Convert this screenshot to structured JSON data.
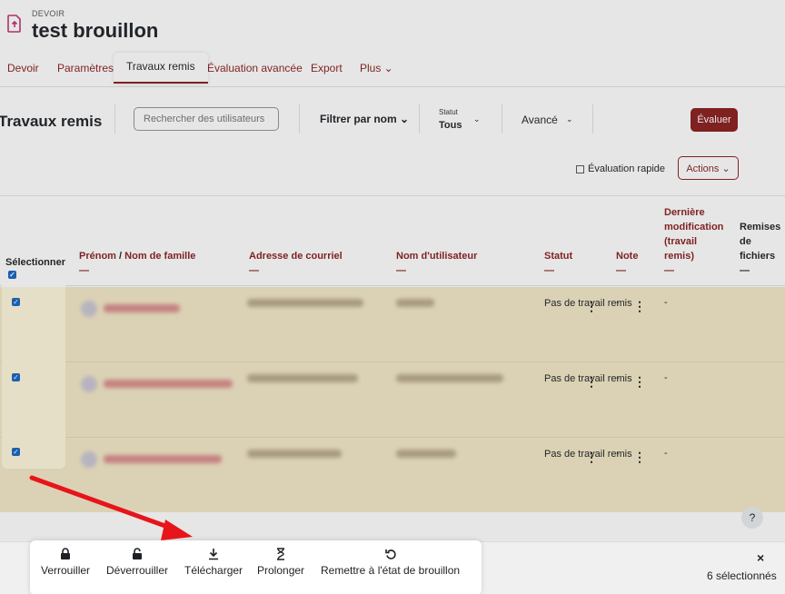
{
  "header": {
    "kicker": "DEVOIR",
    "title": "test brouillon"
  },
  "tabs": [
    {
      "label": "Devoir"
    },
    {
      "label": "Paramètres"
    },
    {
      "label": "Travaux remis"
    },
    {
      "label": "Évaluation avancée"
    },
    {
      "label": "Export"
    },
    {
      "label": "Plus ⌄"
    }
  ],
  "toolbar": {
    "title": "Travaux remis",
    "search_placeholder": "Rechercher des utilisateurs",
    "filter_name": "Filtrer par nom ⌄",
    "status_label": "Statut",
    "status_value": "Tous",
    "advanced": "Avancé",
    "evaluate": "Évaluer"
  },
  "row2": {
    "quick_eval": "Évaluation rapide",
    "actions": "Actions ⌄"
  },
  "table": {
    "select_header": "Sélectionner",
    "headers": {
      "firstname": "Prénom",
      "lastname": "Nom de famille",
      "email": "Adresse de courriel",
      "username": "Nom d'utilisateur",
      "status": "Statut",
      "grade": "Note",
      "lastmod": "Dernière modification (travail remis)",
      "files": "Remises de fichiers"
    },
    "dash": "—",
    "rows": [
      {
        "status": "Pas de travail remis",
        "grade": "-",
        "lastmod": "-"
      },
      {
        "status": "Pas de travail remis",
        "grade": "-",
        "lastmod": "-"
      },
      {
        "status": "Pas de travail remis",
        "grade": "-",
        "lastmod": "-"
      }
    ]
  },
  "bulk": {
    "lock": "Verrouiller",
    "unlock": "Déverrouiller",
    "download": "Télécharger",
    "extend": "Prolonger",
    "revert": "Remettre à l'état de brouillon",
    "close": "×",
    "selected": "6 sélectionnés"
  },
  "help": "?",
  "colors": {
    "accent": "#8a1d1d",
    "highlight": "#f3e8c7",
    "arrow": "#e8141b"
  }
}
